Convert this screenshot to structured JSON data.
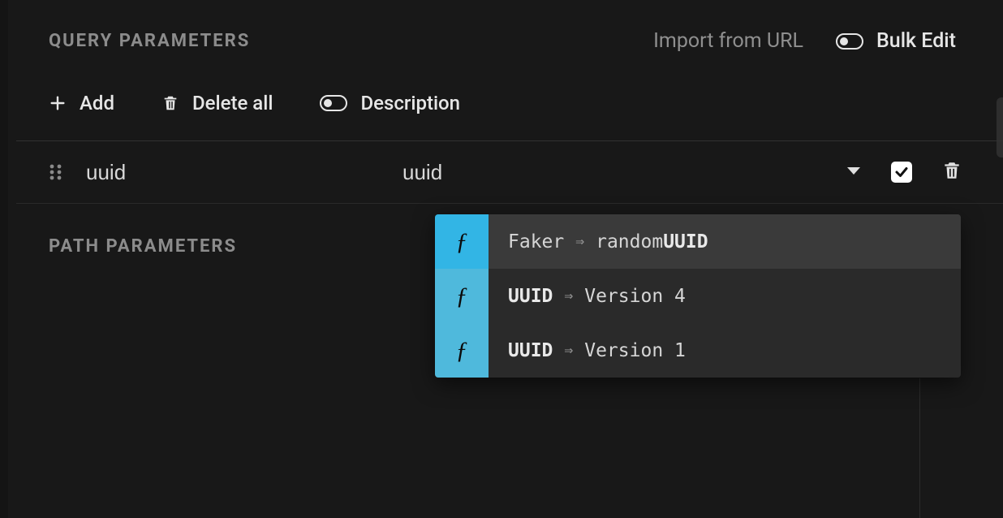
{
  "sections": {
    "query": {
      "title": "Query Parameters"
    },
    "path": {
      "title": "Path Parameters"
    }
  },
  "header": {
    "import_label": "Import from URL",
    "bulk_edit_label": "Bulk Edit"
  },
  "toolbar": {
    "add_label": "Add",
    "delete_all_label": "Delete all",
    "description_label": "Description"
  },
  "params": [
    {
      "key": "uuid",
      "value": "uuid",
      "enabled": true
    }
  ],
  "autocomplete": {
    "badge_glyph": "ƒ",
    "items": [
      {
        "group": "Faker",
        "label_prefix": "random",
        "label_bold": "UUID",
        "highlighted": true
      },
      {
        "group_bold": "UUID",
        "label": "Version 4",
        "highlighted": false
      },
      {
        "group_bold": "UUID",
        "label": "Version 1",
        "highlighted": false
      }
    ]
  }
}
